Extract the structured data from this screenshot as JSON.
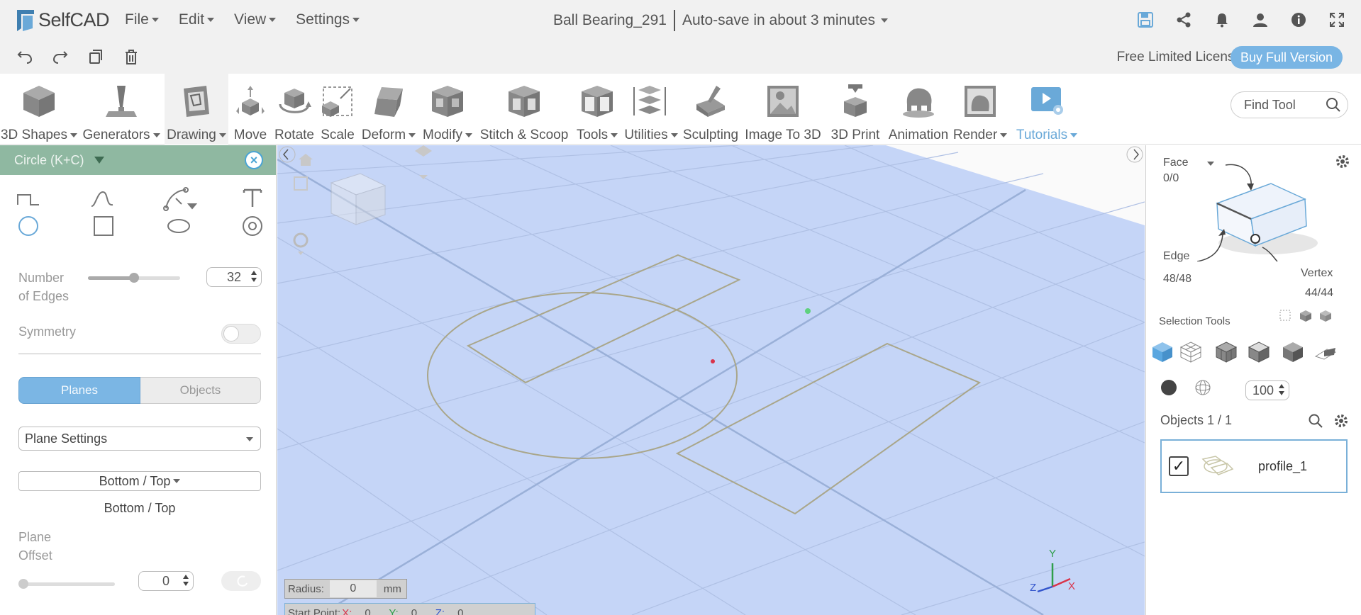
{
  "app": {
    "name": "SelfCAD"
  },
  "menu": [
    {
      "label": "File"
    },
    {
      "label": "Edit"
    },
    {
      "label": "View"
    },
    {
      "label": "Settings"
    }
  ],
  "document": {
    "title": "Ball Bearing_291",
    "autosave": "Auto-save in about 3 minutes"
  },
  "license": {
    "text": "Free Limited License",
    "buy_label": "Buy Full Version"
  },
  "toolbar": {
    "tools": [
      {
        "label": "3D Shapes",
        "dropdown": true
      },
      {
        "label": "Generators",
        "dropdown": true
      },
      {
        "label": "Drawing",
        "dropdown": true,
        "active": true
      },
      {
        "label": "Move"
      },
      {
        "label": "Rotate"
      },
      {
        "label": "Scale"
      },
      {
        "label": "Deform",
        "dropdown": true
      },
      {
        "label": "Modify",
        "dropdown": true
      },
      {
        "label": "Stitch & Scoop"
      },
      {
        "label": "Tools",
        "dropdown": true
      },
      {
        "label": "Utilities",
        "dropdown": true
      },
      {
        "label": "Sculpting"
      },
      {
        "label": "Image To 3D"
      },
      {
        "label": "3D Print"
      },
      {
        "label": "Animation"
      },
      {
        "label": "Render",
        "dropdown": true
      },
      {
        "label": "Tutorials",
        "dropdown": true
      }
    ],
    "find_placeholder": "Find Tool"
  },
  "left_panel": {
    "title": "Circle (K+C)",
    "number_of_edges_label_1": "Number",
    "number_of_edges_label_2": "of Edges",
    "number_of_edges": "32",
    "edges_slider_fraction": 0.5,
    "symmetry_label": "Symmetry",
    "symmetry_on": false,
    "tab_planes": "Planes",
    "tab_objects": "Objects",
    "plane_settings": "Plane Settings",
    "plane_button": "Bottom / Top",
    "plane_current": "Bottom / Top",
    "plane_offset_label_1": "Plane",
    "plane_offset_label_2": "Offset",
    "plane_offset": "0"
  },
  "viewport": {
    "radius_label": "Radius:",
    "radius_value": "0",
    "radius_unit": "mm",
    "start_point_label": "Start Point:",
    "sp_x_label": "X:",
    "sp_x": "0",
    "sp_y_label": "Y:",
    "sp_y": "0",
    "sp_z_label": "Z:",
    "sp_z": "0",
    "axis_y": "Y",
    "axis_x": "X",
    "axis_z": "Z"
  },
  "right_panel": {
    "face_label": "Face",
    "face_count": "0/0",
    "edge_label": "Edge",
    "edge_count": "48/48",
    "vertex_label": "Vertex",
    "vertex_count": "44/44",
    "selection_tools_label": "Selection Tools",
    "opacity_value": "100",
    "objects_label": "Objects 1 / 1",
    "object_name": "profile_1"
  },
  "colors": {
    "accent": "#79b5e4",
    "panel_header": "#8fb8a1",
    "grid_plane": "#c5d5f7",
    "sketch_line": "#a9a68a"
  }
}
